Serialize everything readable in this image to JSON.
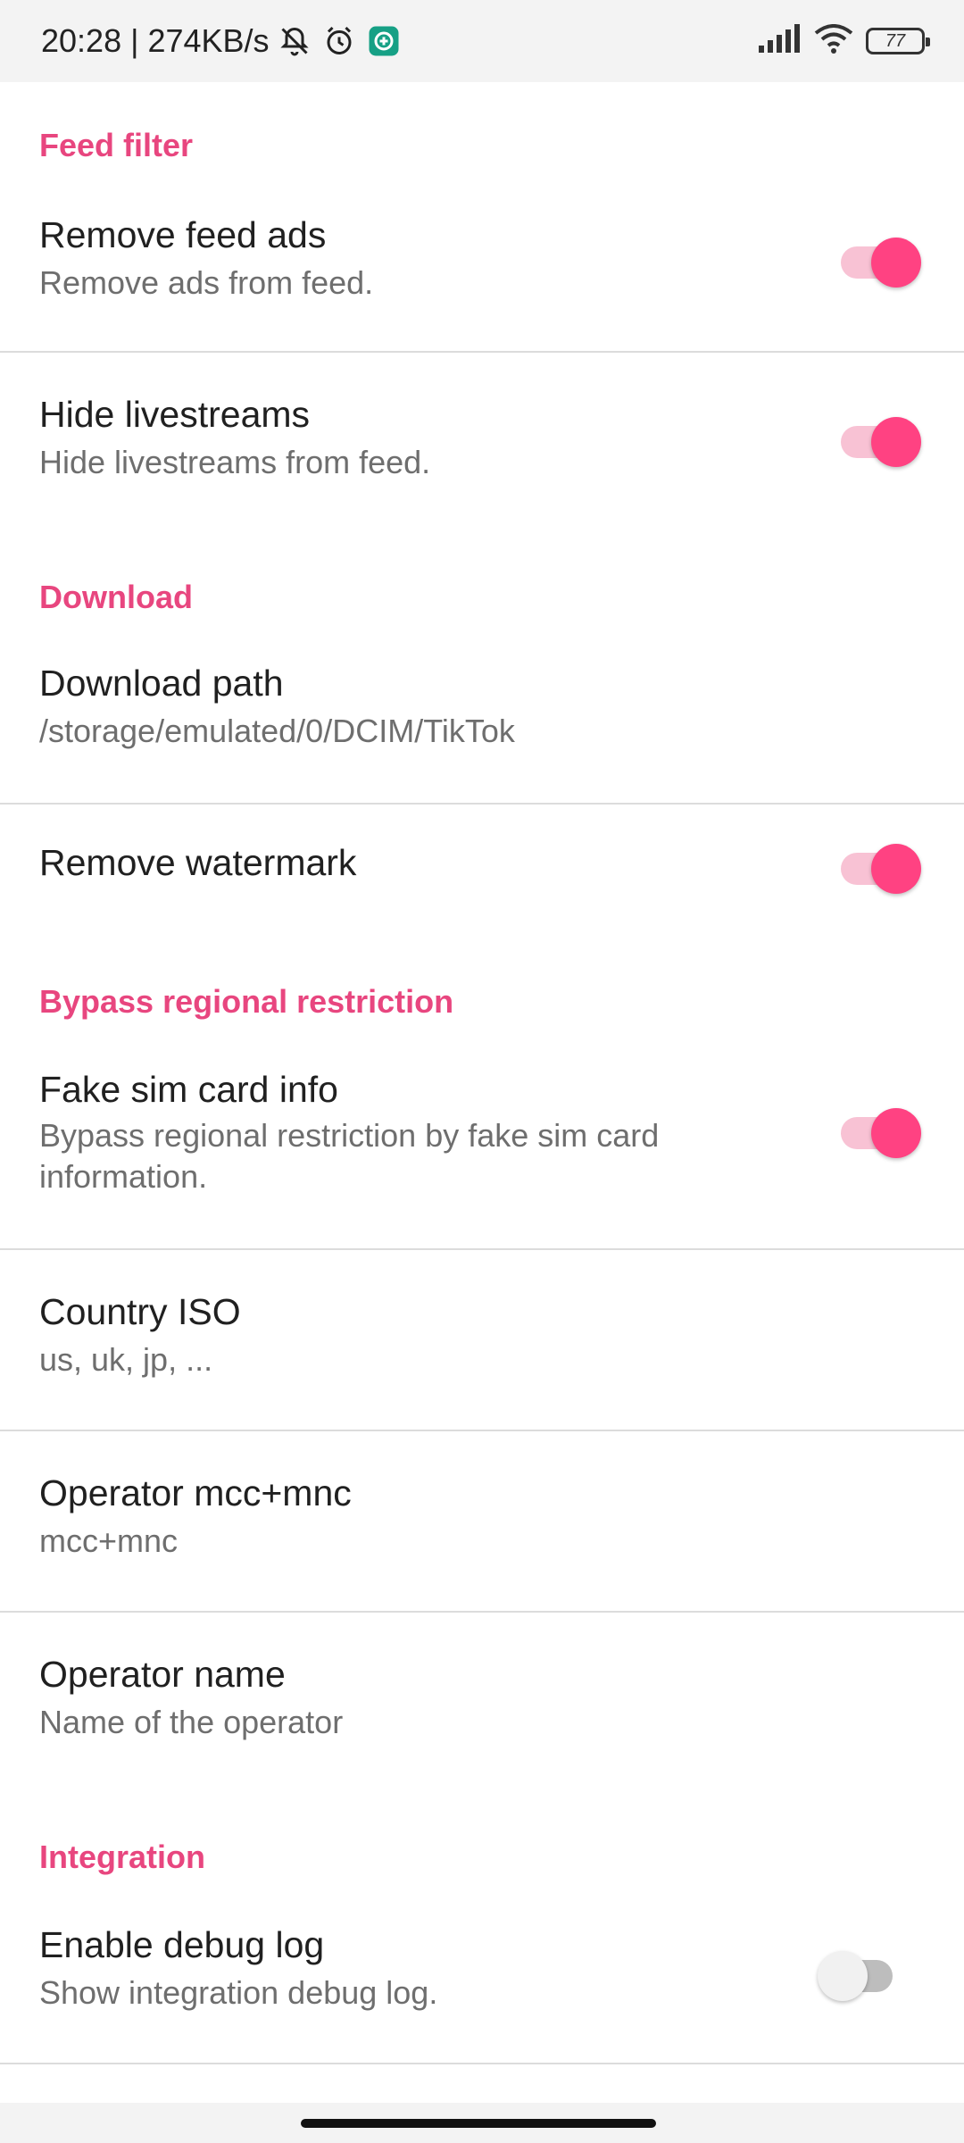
{
  "status_bar": {
    "time_speed": "20:28 | 274KB/s",
    "battery": "77",
    "icons": [
      "bell-off-icon",
      "alarm-icon",
      "shield-app-icon",
      "signal-icon",
      "wifi-icon",
      "battery-icon"
    ]
  },
  "sections": {
    "feed_filter": {
      "title": "Feed filter",
      "remove_feed_ads": {
        "title": "Remove feed ads",
        "summary": "Remove ads from feed.",
        "enabled": true
      },
      "hide_livestreams": {
        "title": "Hide livestreams",
        "summary": "Hide livestreams from feed.",
        "enabled": true
      }
    },
    "download": {
      "title": "Download",
      "download_path": {
        "title": "Download path",
        "summary": "/storage/emulated/0/DCIM/TikTok"
      },
      "remove_watermark": {
        "title": "Remove watermark",
        "enabled": true
      }
    },
    "bypass": {
      "title": "Bypass regional restriction",
      "fake_sim": {
        "title": "Fake sim card info",
        "summary": "Bypass regional restriction by fake sim card information.",
        "enabled": true
      },
      "country_iso": {
        "title": "Country ISO",
        "summary": "us, uk, jp, ..."
      },
      "operator_mcc": {
        "title": "Operator mcc+mnc",
        "summary": "mcc+mnc"
      },
      "operator_name": {
        "title": "Operator name",
        "summary": "Name of the operator"
      }
    },
    "integration": {
      "title": "Integration",
      "debug_log": {
        "title": "Enable debug log",
        "summary": "Show integration debug log.",
        "enabled": false
      }
    }
  },
  "colors": {
    "accent": "#e8467f",
    "switch_on_thumb": "#ff4282",
    "switch_on_track": "#f8c2d4"
  }
}
